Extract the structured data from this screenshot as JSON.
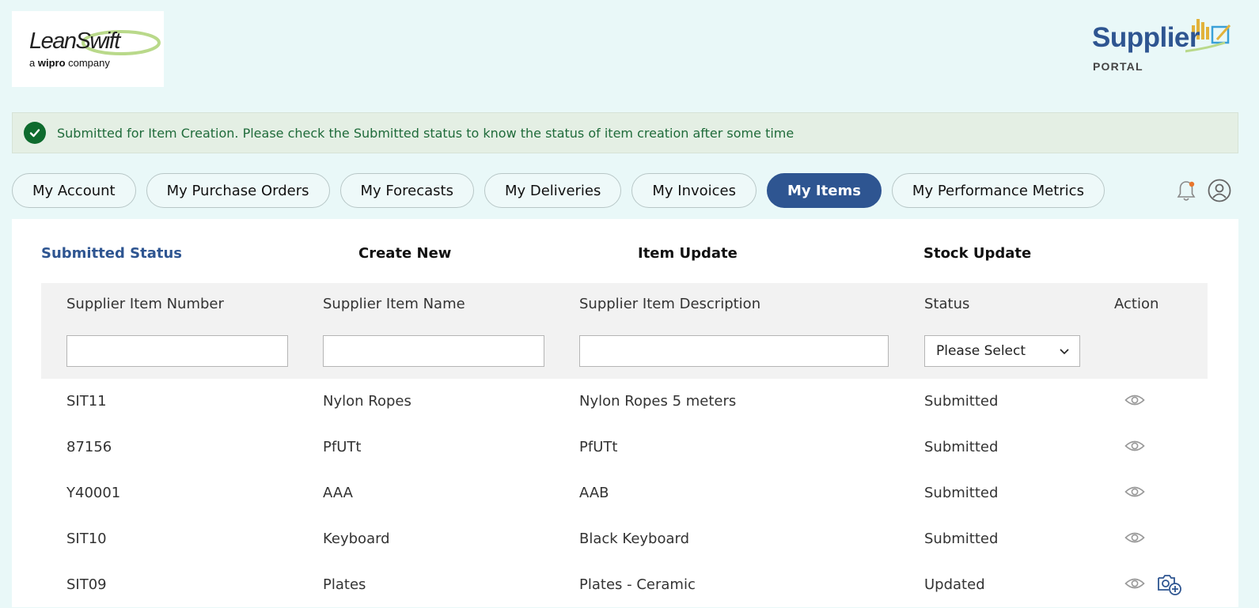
{
  "brand": {
    "logo_main": "LeanSwift",
    "logo_sub_prefix": "a ",
    "logo_sub_bold": "wipro",
    "logo_sub_suffix": " company",
    "portal_word": "Supplier",
    "portal_sub": "PORTAL"
  },
  "alert": {
    "message": "Submitted for Item Creation. Please check the Submitted status to know the status of item creation after some time"
  },
  "nav": {
    "items": [
      {
        "label": "My Account"
      },
      {
        "label": "My Purchase Orders"
      },
      {
        "label": "My Forecasts"
      },
      {
        "label": "My Deliveries"
      },
      {
        "label": "My Invoices"
      },
      {
        "label": "My Items"
      },
      {
        "label": "My Performance Metrics"
      }
    ],
    "active": "My Items"
  },
  "subtabs": [
    {
      "label": "Submitted Status"
    },
    {
      "label": "Create New"
    },
    {
      "label": "Item Update"
    },
    {
      "label": "Stock Update"
    }
  ],
  "table": {
    "columns": [
      "Supplier Item Number",
      "Supplier Item Name",
      "Supplier Item Description",
      "Status",
      "Action"
    ],
    "filters": {
      "item_number": "",
      "item_name": "",
      "item_description": "",
      "status_selected": "Please Select"
    },
    "rows": [
      {
        "number": "SIT11",
        "name": "Nylon Ropes",
        "description": "Nylon Ropes 5 meters",
        "status": "Submitted"
      },
      {
        "number": "87156",
        "name": "PfUTt",
        "description": "PfUTt",
        "status": "Submitted"
      },
      {
        "number": "Y40001",
        "name": "AAA",
        "description": "AAB",
        "status": "Submitted"
      },
      {
        "number": "SIT10",
        "name": "Keyboard",
        "description": "Black Keyboard",
        "status": "Submitted"
      },
      {
        "number": "SIT09",
        "name": "Plates",
        "description": "Plates - Ceramic",
        "status": "Updated"
      }
    ]
  },
  "colors": {
    "accent": "#2e5591",
    "page_bg": "#e9f8f8",
    "success": "#0e6b2e",
    "alert_bg": "#e4efe4"
  }
}
